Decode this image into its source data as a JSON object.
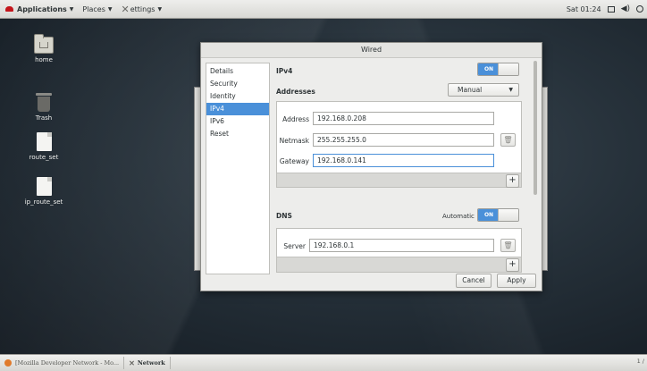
{
  "topbar": {
    "applications": "Applications",
    "places": "Places",
    "settings": "ettings",
    "clock": "Sat 01:24"
  },
  "desktop_icons": [
    {
      "label": "home",
      "icon": "home-folder-icon"
    },
    {
      "label": "Trash",
      "icon": "trash-icon"
    },
    {
      "label": "route_set",
      "icon": "file-icon"
    },
    {
      "label": "ip_route_set",
      "icon": "file-icon"
    }
  ],
  "dialog": {
    "title": "Wired",
    "sidebar": [
      "Details",
      "Security",
      "Identity",
      "IPv4",
      "IPv6",
      "Reset"
    ],
    "selected_tab": "IPv4",
    "ipv4_label": "IPv4",
    "ipv4_toggle": "ON",
    "addresses_label": "Addresses",
    "addresses_method": "Manual",
    "address_label": "Address",
    "address_value": "192.168.0.208",
    "netmask_label": "Netmask",
    "netmask_value": "255.255.255.0",
    "gateway_label": "Gateway",
    "gateway_value": "192.168.0.141",
    "dns_label": "DNS",
    "dns_automatic_label": "Automatic",
    "dns_toggle": "ON",
    "server_label": "Server",
    "server_value": "192.168.0.1",
    "add_symbol": "+",
    "cancel_label": "Cancel",
    "apply_label": "Apply",
    "accent_color": "#4a90d9"
  },
  "taskbar": {
    "tasks": [
      "[Mozilla Developer Network - Mo...",
      "Network"
    ],
    "pager": "1 /"
  }
}
